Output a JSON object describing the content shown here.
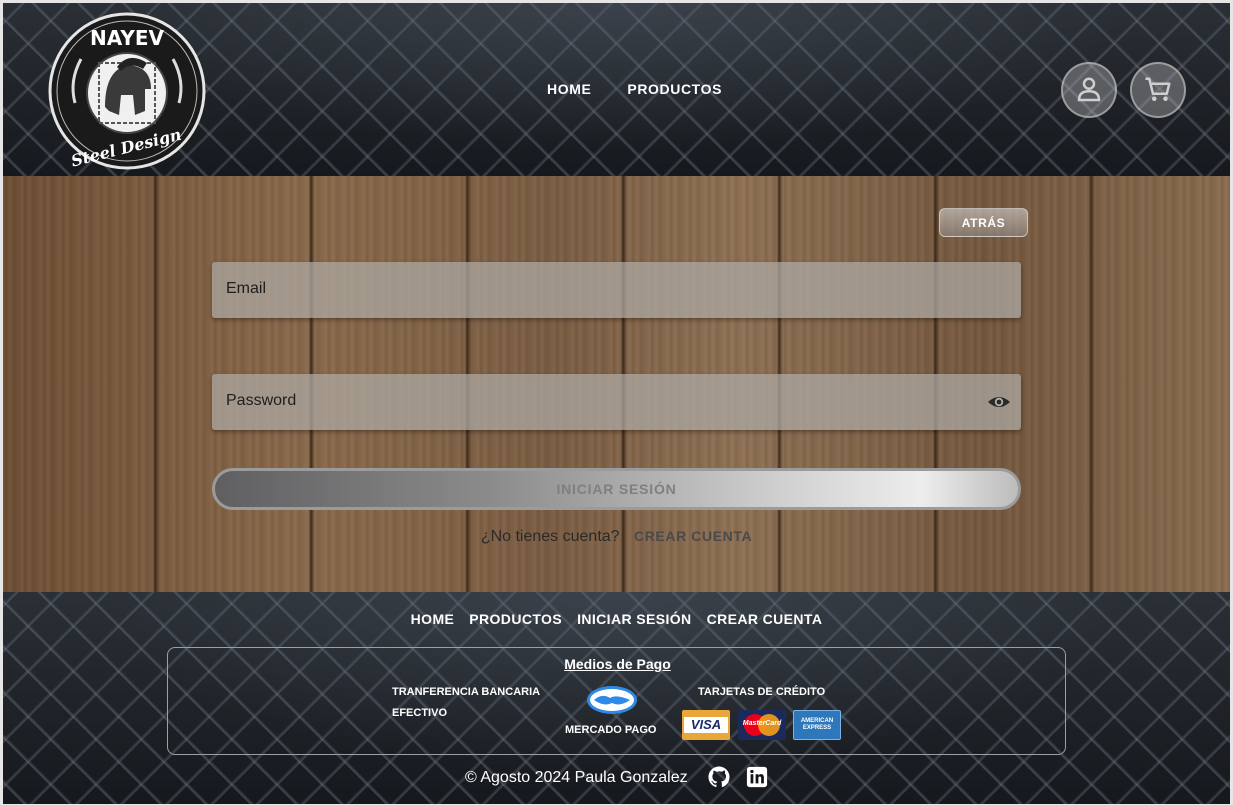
{
  "header": {
    "logo": {
      "top_text": "NAYEV",
      "bottom_text": "Steel Design"
    },
    "nav": [
      "HOME",
      "PRODUCTOS"
    ],
    "icons": {
      "user": "user-icon",
      "cart": "cart-icon"
    }
  },
  "login": {
    "back_label": "ATRÁS",
    "email_placeholder": "Email",
    "password_placeholder": "Password",
    "submit_label": "INICIAR SESIÓN",
    "no_account_text": "¿No tienes cuenta?",
    "create_account_label": "CREAR CUENTA",
    "icons": {
      "toggle_password": "eye-icon"
    }
  },
  "footer": {
    "nav": [
      "HOME",
      "PRODUCTOS",
      "INICIAR SESIÓN",
      "CREAR CUENTA"
    ],
    "payments": {
      "title": "Medios de Pago",
      "transfer": "TRANFERENCIA BANCARIA",
      "cash": "EFECTIVO",
      "mercado_pago": "MERCADO PAGO",
      "credit_cards": "TARJETAS DE CRÉDITO",
      "card_visa": "VISA",
      "card_mastercard": "MasterCard",
      "card_amex": "AMERICAN EXPRESS"
    },
    "copyright": "© Agosto 2024 Paula Gonzalez",
    "icons": {
      "github": "github-icon",
      "linkedin": "linkedin-icon"
    }
  },
  "colors": {
    "header_bg": "#15181c",
    "wood": "#7a5a3e",
    "field_bg": "#afaaa5",
    "visa_gold": "#e8a63b",
    "visa_blue": "#1a2a6c",
    "amex_blue": "#2e77bb",
    "mastercard_red": "#eb001b",
    "mastercard_orange": "#f79e1b"
  }
}
